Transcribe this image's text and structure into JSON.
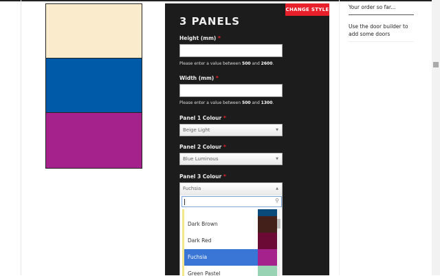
{
  "door": {
    "colors": [
      "#faebcc",
      "#005aa8",
      "#a5228c"
    ]
  },
  "form": {
    "change_style": "CHANGE STYLE",
    "title": "3 PANELS",
    "required": "*",
    "height_label": "Height (mm)",
    "height_value": "",
    "height_help": {
      "pre": "Please enter a value between ",
      "min": "500",
      "mid": " and ",
      "max": "2600",
      "post": "."
    },
    "width_label": "Width (mm)",
    "width_value": "",
    "width_help": {
      "pre": "Please enter a value between ",
      "min": "500",
      "mid": " and ",
      "max": "1300",
      "post": "."
    },
    "panel1_label": "Panel 1 Colour",
    "panel1_value": "Beige Light",
    "panel2_label": "Panel 2 Colour",
    "panel2_value": "Blue Luminous",
    "panel3_label": "Panel 3 Colour",
    "panel3_value": "Fuchsia",
    "dropdown": {
      "search": "",
      "options": [
        {
          "label": "",
          "color": "#0a4a7a"
        },
        {
          "label": "Dark Brown",
          "color": "#432019"
        },
        {
          "label": "Dark Red",
          "color": "#6a0a35"
        },
        {
          "label": "Fuchsia",
          "color": "#a5228c",
          "selected": true
        },
        {
          "label": "Green Pastel",
          "color": "#98d4b4"
        }
      ]
    }
  },
  "sidebar": {
    "heading": "Your order so far...",
    "empty": "Use the door builder to add some doors"
  }
}
